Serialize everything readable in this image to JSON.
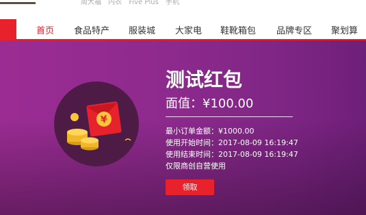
{
  "topbar": {
    "hot_words": [
      "周大福",
      "内衣",
      "Five Plus",
      "手机"
    ]
  },
  "nav": {
    "items": [
      {
        "label": "首页",
        "active": true
      },
      {
        "label": "食品特产",
        "active": false
      },
      {
        "label": "服装城",
        "active": false
      },
      {
        "label": "大家电",
        "active": false
      },
      {
        "label": "鞋靴箱包",
        "active": false
      },
      {
        "label": "品牌专区",
        "active": false
      },
      {
        "label": "聚划算",
        "active": false
      }
    ],
    "accent_color": "#e8222d"
  },
  "coupon": {
    "title": "测试红包",
    "face_value": "面值：¥100.00",
    "min_order": "最小订单金额：¥1000.00",
    "start_time": "使用开始时间：2017-08-09 16:19:47",
    "end_time": "使用结束时间：2017-08-09 16:19:47",
    "scope": "仅限商创自营使用",
    "claim_button": "领取",
    "envelope_symbol": "¥",
    "banner_color": "#8e2a8e"
  }
}
